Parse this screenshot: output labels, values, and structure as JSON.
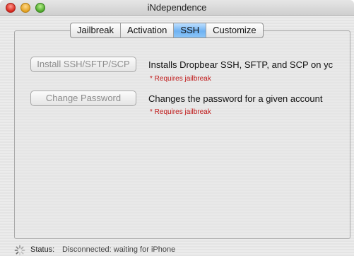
{
  "window": {
    "title": "iNdependence"
  },
  "tabs": [
    {
      "label": "Jailbreak"
    },
    {
      "label": "Activation"
    },
    {
      "label": "SSH",
      "selected": true
    },
    {
      "label": "Customize"
    }
  ],
  "ssh": {
    "install": {
      "button_label": "Install SSH/SFTP/SCP",
      "description": "Installs Dropbear SSH, SFTP, and SCP on yc",
      "requirement": "* Requires jailbreak"
    },
    "change_password": {
      "button_label": "Change Password",
      "description": "Changes the password for a given account",
      "requirement": "* Requires jailbreak"
    }
  },
  "status": {
    "label": "Status:",
    "text": "Disconnected: waiting for iPhone"
  },
  "colors": {
    "accent_tab": "#6fb2f2",
    "requirement_text": "#c01818",
    "disabled_button_text": "#8c8c8c"
  }
}
